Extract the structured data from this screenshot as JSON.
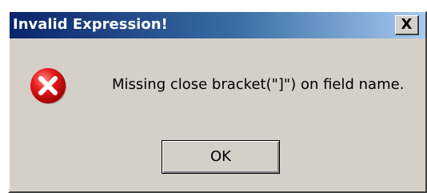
{
  "window": {
    "title": "Invalid Expression!",
    "close_label": "X"
  },
  "dialog": {
    "icon": "error-icon",
    "message": "Missing close bracket(\"]\") on field name.",
    "ok_label": "OK"
  },
  "colors": {
    "titlebar_start": "#0a246a",
    "titlebar_end": "#a6caf0",
    "dialog_background": "#d4d0c8",
    "error_red": "#e81c1c"
  }
}
